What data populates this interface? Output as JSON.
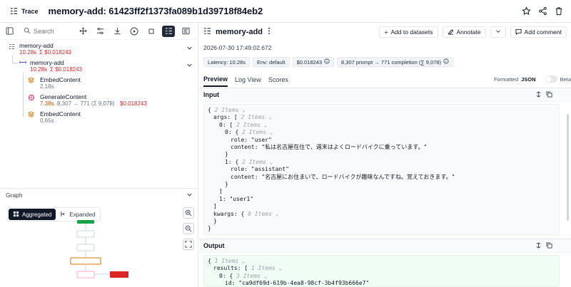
{
  "header": {
    "trace_label": "Trace",
    "title": "memory-add: 61423ff2f1373fa089b1d39718f84eb2"
  },
  "left": {
    "search_placeholder": "Search",
    "nodes": [
      {
        "name": "memory-add",
        "latency": "10.28s",
        "cost": "Σ $0.018243"
      },
      {
        "name": "memory-add",
        "latency": "10.28s",
        "cost": "Σ $0.018243"
      },
      {
        "name": "EmbedContent",
        "latency": "2.18s"
      },
      {
        "name": "GenerateContent",
        "latency": "7.38s",
        "tokens": "8,307 → 771 (Σ 9,078)",
        "cost": "$0.018243"
      },
      {
        "name": "EmbedContent",
        "latency": "0.65s"
      }
    ],
    "graph": {
      "title": "Graph",
      "aggregated": "Aggregated",
      "expanded": "Expanded"
    }
  },
  "right": {
    "title": "memory-add",
    "actions": {
      "add_datasets": "Add to datasets",
      "annotate": "Annotate",
      "add_comment": "Add comment"
    },
    "timestamp": "2026-07-30 17:49:02.672",
    "badges": {
      "latency": "Latency: 10.28s",
      "env": "Env: default",
      "cost": "$0.018243",
      "tokens": "8,307 prompt → 771 completion (∑ 9,078)"
    },
    "tabs": [
      "Preview",
      "Log View",
      "Scores"
    ],
    "format": {
      "formatted": "Formatted",
      "json": "JSON",
      "beta": "Beta"
    },
    "input_label": "Input",
    "output_label": "Output",
    "input_lines": [
      {
        "t": "{",
        "c": "2 Items"
      },
      {
        "t": "args: [",
        "c": "2 Items"
      },
      {
        "t": "0: [",
        "c": "2 Items"
      },
      {
        "t": "0: {",
        "c": "2 Items"
      },
      {
        "t": "role: \"user\"",
        "c": ""
      },
      {
        "t": "content: \"私は名古屋在住で、週末はよくロードバイクに乗っています。\"",
        "c": ""
      },
      {
        "t": "}",
        "c": ""
      },
      {
        "t": "1: {",
        "c": "2 Items"
      },
      {
        "t": "role: \"assistant\"",
        "c": ""
      },
      {
        "t": "content: \"名古屋にお住まいで、ロードバイクが趣味なんですね。覚えておきます。\"",
        "c": ""
      },
      {
        "t": "}",
        "c": ""
      },
      {
        "t": "]",
        "c": ""
      },
      {
        "t": "1: \"user1\"",
        "c": ""
      },
      {
        "t": "]",
        "c": ""
      },
      {
        "t": "kwargs: {",
        "c": "0 Items"
      },
      {
        "t": "}",
        "c": ""
      },
      {
        "t": "}",
        "c": ""
      }
    ],
    "output_lines": [
      {
        "t": "{",
        "c": "1 Items"
      },
      {
        "t": "results: [",
        "c": "1 Items"
      },
      {
        "t": "0: {",
        "c": "3 Items"
      },
      {
        "t": "id: \"ca9df69d-619b-4ea8-98cf-3b4f93b666e7\"",
        "c": ""
      }
    ]
  }
}
